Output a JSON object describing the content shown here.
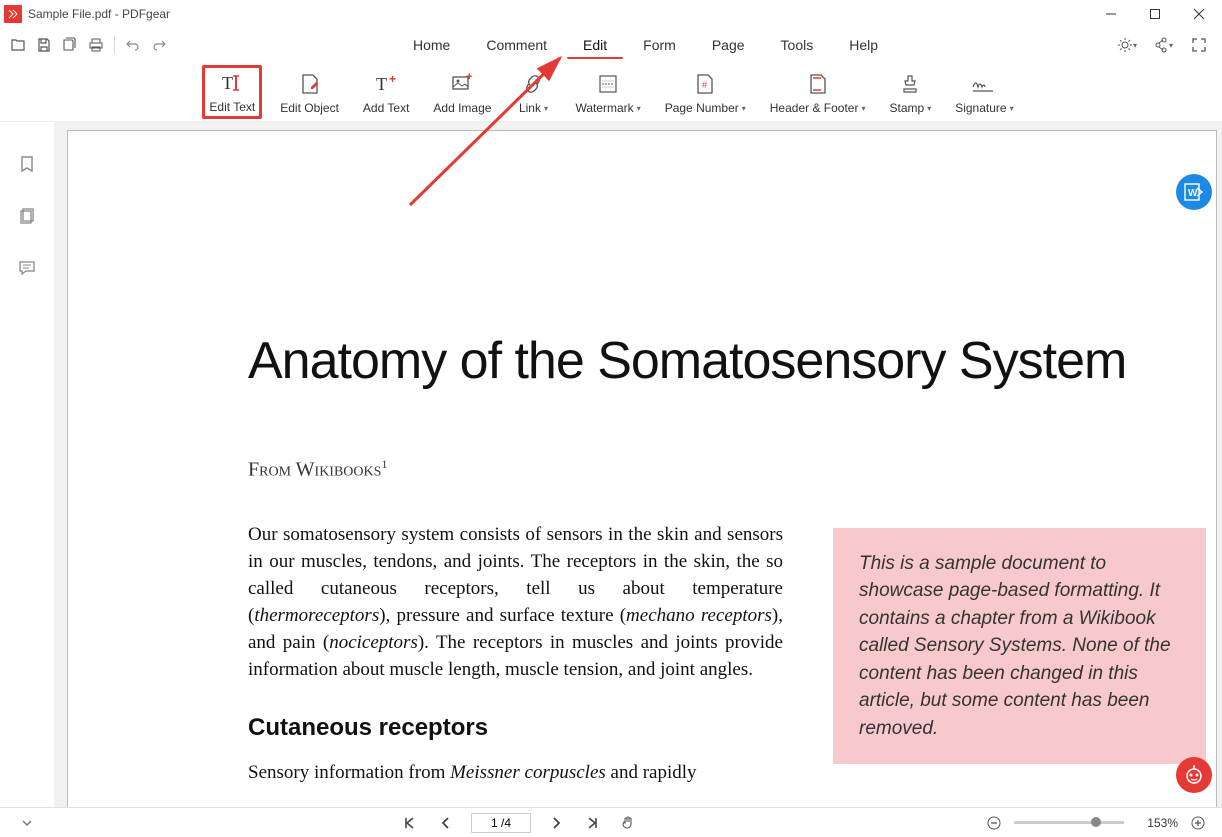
{
  "title_bar": {
    "document_name": "Sample File.pdf",
    "app_name": "PDFgear",
    "full_title": "Sample File.pdf - PDFgear"
  },
  "menu": {
    "items": [
      "Home",
      "Comment",
      "Edit",
      "Form",
      "Page",
      "Tools",
      "Help"
    ],
    "active_index": 2
  },
  "ribbon": {
    "edit_text": "Edit Text",
    "edit_object": "Edit Object",
    "add_text": "Add Text",
    "add_image": "Add Image",
    "link": "Link",
    "watermark": "Watermark",
    "page_number": "Page Number",
    "header_footer": "Header & Footer",
    "stamp": "Stamp",
    "signature": "Signature"
  },
  "document": {
    "title": "Anatomy of the Somatosensory System",
    "subtitle_prefix": "From Wikibooks",
    "subtitle_sup": "1",
    "paragraph1_html": "Our somatosensory system consists of sensors in the skin and sensors in our muscles, tendons, and joints. The receptors in the skin, the so called cutaneous receptors, tell us about temperature (<em>thermoreceptors</em>), pressure and surface texture (<em>mechano receptors</em>), and pain (<em>nociceptors</em>). The receptors in muscles and joints provide information about muscle length, muscle tension, and joint angles.",
    "heading2": "Cutaneous receptors",
    "paragraph2_html": "Sensory information from <em>Meissner corpuscles</em> and rapidly",
    "sidebar_text": "This is a sample document to showcase page-based formatting. It contains a chapter from a Wikibook called Sensory Systems. None of the content has been changed in this article, but some content has been removed."
  },
  "status": {
    "page_current": 1,
    "page_total": 4,
    "page_display": "1 /4",
    "zoom": "153%"
  }
}
